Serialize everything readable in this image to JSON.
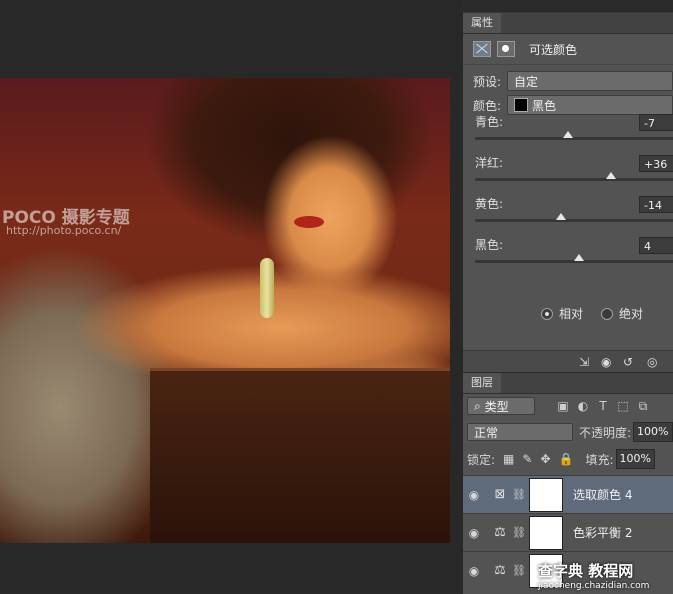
{
  "photo": {
    "watermark_logo": "POCO 摄影专题",
    "watermark_url": "http://photo.poco.cn/"
  },
  "properties": {
    "tab": "属性",
    "title": "可选颜色",
    "preset_label": "预设:",
    "preset_value": "自定",
    "color_label": "颜色:",
    "color_value": "黑色",
    "sliders": [
      {
        "label": "青色:",
        "value": "-7",
        "level": -0.07
      },
      {
        "label": "洋红:",
        "value": "+36",
        "level": 0.36
      },
      {
        "label": "黄色:",
        "value": "-14",
        "level": -0.14
      },
      {
        "label": "黑色:",
        "value": "4",
        "level": 0.04
      }
    ],
    "radio_relative": "相对",
    "radio_absolute": "绝对"
  },
  "layers": {
    "tab": "图层",
    "filter_kind": "类型",
    "blend_mode": "正常",
    "opacity_label": "不透明度:",
    "opacity_value": "100%",
    "lock_label": "锁定:",
    "fill_label": "填充:",
    "fill_value": "100%",
    "items": [
      {
        "name": "选取颜色 4",
        "icon": "selective-color-icon"
      },
      {
        "name": "色彩平衡 2",
        "icon": "balance-icon"
      }
    ]
  },
  "site_watermark": {
    "title": "查字典 教程网",
    "url": "jiaocheng.chazidian.com"
  }
}
